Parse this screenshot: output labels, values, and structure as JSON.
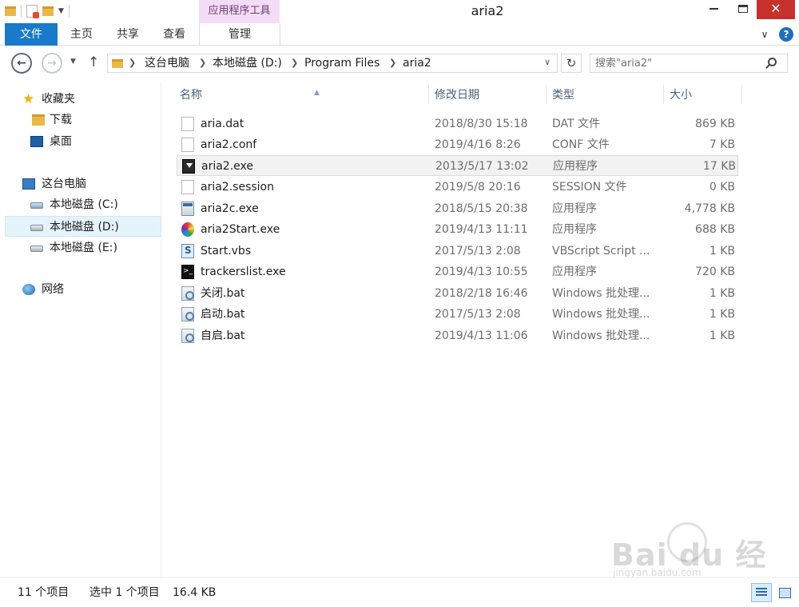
{
  "window": {
    "title": "aria2",
    "contextual_tab_header": "应用程序工具",
    "close_glyph": "✕"
  },
  "ribbon": {
    "tabs": [
      "文件",
      "主页",
      "共享",
      "查看",
      "管理"
    ]
  },
  "address": {
    "crumbs": [
      "这台电脑",
      "本地磁盘 (D:)",
      "Program Files",
      "aria2"
    ],
    "search_placeholder": "搜索\"aria2\""
  },
  "sidebar": {
    "favorites_label": "收藏夹",
    "downloads_label": "下载",
    "desktop_label": "桌面",
    "this_pc_label": "这台电脑",
    "drive_c_label": "本地磁盘 (C:)",
    "drive_d_label": "本地磁盘 (D:)",
    "drive_e_label": "本地磁盘 (E:)",
    "network_label": "网络"
  },
  "filelist": {
    "columns": [
      "名称",
      "修改日期",
      "类型",
      "大小"
    ],
    "selected_index": 2,
    "rows": [
      {
        "name": "aria.dat",
        "date": "2018/8/30 15:18",
        "type": "DAT 文件",
        "size": "869 KB",
        "icon": "document-icon"
      },
      {
        "name": "aria2.conf",
        "date": "2019/4/16 8:26",
        "type": "CONF 文件",
        "size": "7 KB",
        "icon": "document-icon"
      },
      {
        "name": "aria2.exe",
        "date": "2013/5/17 13:02",
        "type": "应用程序",
        "size": "17 KB",
        "icon": "aria2-app-icon"
      },
      {
        "name": "aria2.session",
        "date": "2019/5/8 20:16",
        "type": "SESSION 文件",
        "size": "0 KB",
        "icon": "document-icon"
      },
      {
        "name": "aria2c.exe",
        "date": "2018/5/15 20:38",
        "type": "应用程序",
        "size": "4,778 KB",
        "icon": "application-icon"
      },
      {
        "name": "aria2Start.exe",
        "date": "2019/4/13 11:11",
        "type": "应用程序",
        "size": "688 KB",
        "icon": "colorful-app-icon"
      },
      {
        "name": "Start.vbs",
        "date": "2017/5/13 2:08",
        "type": "VBScript Script ...",
        "size": "1 KB",
        "icon": "script-icon"
      },
      {
        "name": "trackerslist.exe",
        "date": "2019/4/13 10:55",
        "type": "应用程序",
        "size": "720 KB",
        "icon": "terminal-app-icon"
      },
      {
        "name": "关闭.bat",
        "date": "2018/2/18 16:46",
        "type": "Windows 批处理...",
        "size": "1 KB",
        "icon": "batch-file-icon"
      },
      {
        "name": "启动.bat",
        "date": "2017/5/13 2:08",
        "type": "Windows 批处理...",
        "size": "1 KB",
        "icon": "batch-file-icon"
      },
      {
        "name": "自启.bat",
        "date": "2019/4/13 11:06",
        "type": "Windows 批处理...",
        "size": "1 KB",
        "icon": "batch-file-icon"
      }
    ]
  },
  "status": {
    "item_count": "11 个项目",
    "selection": "选中 1 个项目",
    "selection_size": "16.4 KB"
  },
  "watermark": {
    "main": "Bai du 经验",
    "sub": "jingyan.baidu.com"
  }
}
